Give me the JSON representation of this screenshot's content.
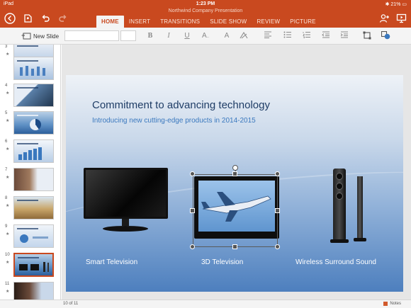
{
  "status_bar": {
    "device": "iPad",
    "time": "1:23 PM",
    "battery": "21%"
  },
  "document": {
    "title": "Northwind Company Presentation"
  },
  "tabs": [
    {
      "label": "HOME",
      "active": true
    },
    {
      "label": "INSERT"
    },
    {
      "label": "TRANSITIONS"
    },
    {
      "label": "SLIDE SHOW"
    },
    {
      "label": "REVIEW"
    },
    {
      "label": "PICTURE"
    }
  ],
  "ribbon": {
    "new_slide_label": "New Slide",
    "font_name": "",
    "font_size": ""
  },
  "thumbnails": [
    {
      "number": "3"
    },
    {
      "number": "4"
    },
    {
      "number": "5"
    },
    {
      "number": "6"
    },
    {
      "number": "7"
    },
    {
      "number": "8"
    },
    {
      "number": "9"
    },
    {
      "number": "10",
      "selected": true
    },
    {
      "number": "11"
    }
  ],
  "slide": {
    "title": "Commitment to advancing technology",
    "subtitle": "Introducing new cutting-edge products in 2014-2015",
    "captions": {
      "smart_tv": "Smart Television",
      "tv_3d": "3D Television",
      "speakers": "Wireless Surround Sound"
    }
  },
  "footer": {
    "page_indicator": "10 of 11",
    "notes_label": "Notes"
  },
  "colors": {
    "accent": "#c9491f",
    "slide_title": "#1f3d66",
    "slide_subtitle": "#3a78be"
  }
}
